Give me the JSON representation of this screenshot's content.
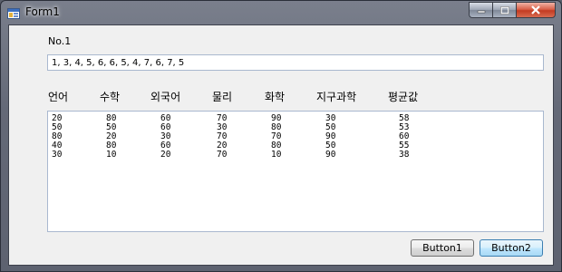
{
  "window": {
    "title": "Form1",
    "caption": {
      "minimize": "–",
      "maximize": "□",
      "close": "X"
    }
  },
  "form": {
    "no_label": "No.1",
    "input_value": "1, 3, 4, 5, 6, 6, 5, 4, 7, 6, 7, 5"
  },
  "table": {
    "headers": [
      "언어",
      "수학",
      "외국어",
      "물리",
      "화학",
      "지구과학",
      "평균값"
    ],
    "rows": [
      [
        "20",
        "80",
        "60",
        "70",
        "90",
        "30",
        "58"
      ],
      [
        "50",
        "50",
        "60",
        "30",
        "80",
        "50",
        "53"
      ],
      [
        "80",
        "20",
        "30",
        "70",
        "70",
        "90",
        "60"
      ],
      [
        "40",
        "80",
        "60",
        "20",
        "80",
        "50",
        "55"
      ],
      [
        "30",
        "10",
        "20",
        "70",
        "10",
        "90",
        "38"
      ]
    ]
  },
  "buttons": {
    "button1": "Button1",
    "button2": "Button2"
  }
}
